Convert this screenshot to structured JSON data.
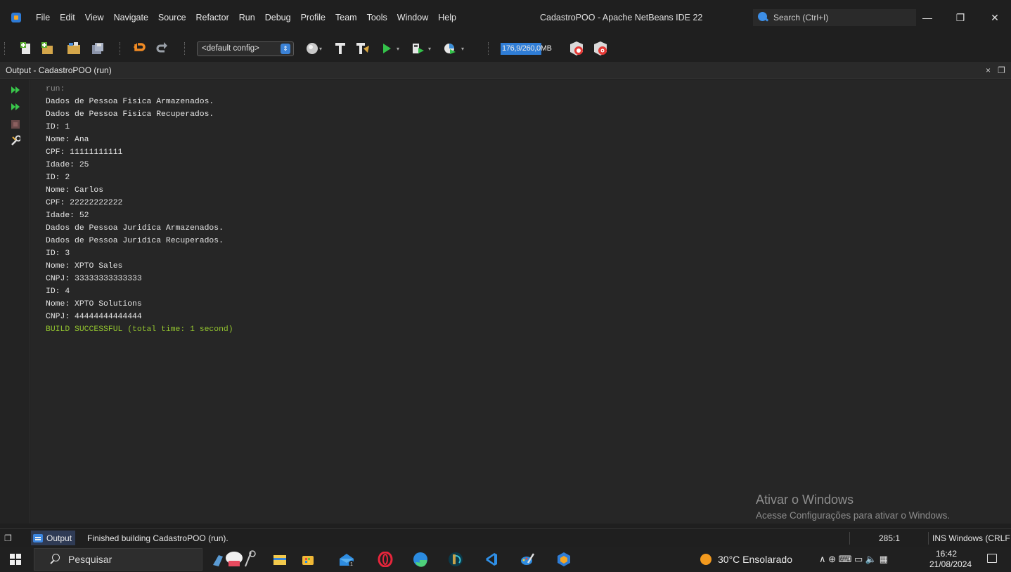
{
  "menubar": {
    "items": [
      "File",
      "Edit",
      "View",
      "Navigate",
      "Source",
      "Refactor",
      "Run",
      "Debug",
      "Profile",
      "Team",
      "Tools",
      "Window",
      "Help"
    ],
    "window_title": "CadastroPOO - Apache NetBeans IDE 22",
    "search_placeholder": "Search (Ctrl+I)"
  },
  "window_controls": {
    "minimize": "—",
    "restore": "❐",
    "close": "✕"
  },
  "toolbar": {
    "config": "<default config>",
    "memory": "176,9/260,0MB",
    "memory_used_fraction": 0.68
  },
  "output_panel": {
    "title": "Output - CadastroPOO (run)",
    "close": "×",
    "restore": "❐",
    "lines": [
      {
        "text": "run:",
        "style": "muted"
      },
      {
        "text": "Dados de Pessoa Fisica Armazenados.",
        "style": "normal"
      },
      {
        "text": "Dados de Pessoa Fisica Recuperados.",
        "style": "normal"
      },
      {
        "text": "ID: 1",
        "style": "normal"
      },
      {
        "text": "Nome: Ana",
        "style": "normal"
      },
      {
        "text": "CPF: 11111111111",
        "style": "normal"
      },
      {
        "text": "Idade: 25",
        "style": "normal"
      },
      {
        "text": "ID: 2",
        "style": "normal"
      },
      {
        "text": "Nome: Carlos",
        "style": "normal"
      },
      {
        "text": "CPF: 22222222222",
        "style": "normal"
      },
      {
        "text": "Idade: 52",
        "style": "normal"
      },
      {
        "text": "Dados de Pessoa Juridica Armazenados.",
        "style": "normal"
      },
      {
        "text": "Dados de Pessoa Juridica Recuperados.",
        "style": "normal"
      },
      {
        "text": "ID: 3",
        "style": "normal"
      },
      {
        "text": "Nome: XPTO Sales",
        "style": "normal"
      },
      {
        "text": "CNPJ: 33333333333333",
        "style": "normal"
      },
      {
        "text": "ID: 4",
        "style": "normal"
      },
      {
        "text": "Nome: XPTO Solutions",
        "style": "normal"
      },
      {
        "text": "CNPJ: 44444444444444",
        "style": "normal"
      },
      {
        "text": "BUILD SUCCESSFUL (total time: 1 second)",
        "style": "success"
      }
    ]
  },
  "watermark": {
    "title": "Ativar o Windows",
    "subtitle": "Acesse Configurações para ativar o Windows."
  },
  "statusbar": {
    "restore": "❐",
    "output_tab": "Output",
    "message": "Finished building CadastroPOO (run).",
    "position": "285:1",
    "ins": "INS  Windows (CRLF"
  },
  "taskbar": {
    "search_placeholder": "Pesquisar",
    "weather": "30°C  Ensolarado",
    "tray": "∧  ⊕  ⌨  ▭  🔈  ▦",
    "time": "16:42",
    "date": "21/08/2024"
  },
  "colors": {
    "accent": "#3b82d6",
    "success": "#93c42f",
    "console_bg": "#262626"
  }
}
